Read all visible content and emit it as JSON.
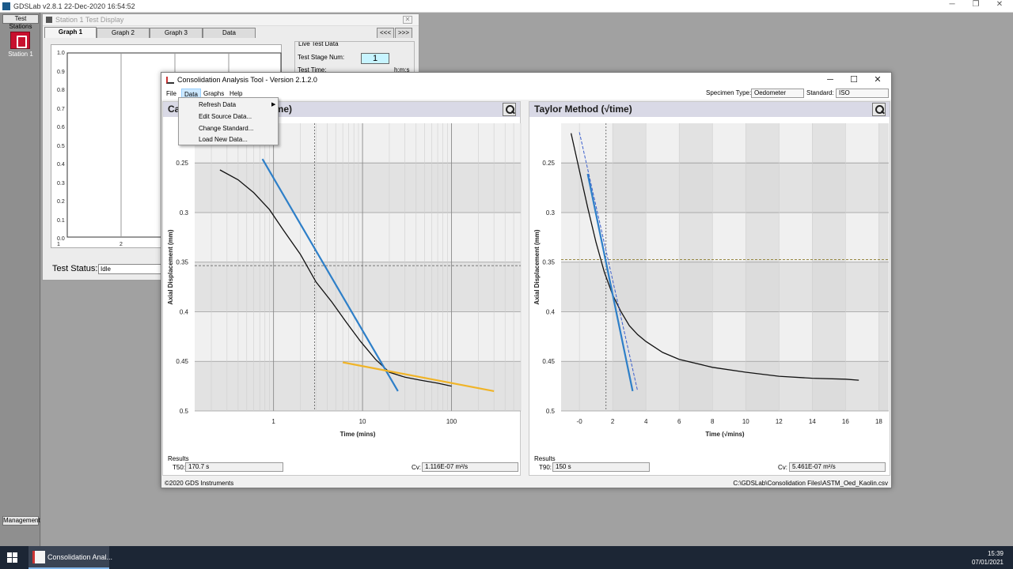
{
  "gdslab": {
    "title": "GDSLab v2.8.1 22-Dec-2020 16:54:52",
    "side_buttons": {
      "test_stations": "Test Stations",
      "management": "Management"
    },
    "station_label": "Station 1"
  },
  "station_window": {
    "title": "Station 1 Test Display",
    "tabs": [
      "Graph 1",
      "Graph 2",
      "Graph 3",
      "Data"
    ],
    "nav": {
      "prev": "<<<",
      "next": ">>>"
    },
    "y_ticks": [
      "1.0",
      "0.9",
      "0.8",
      "0.7",
      "0.6",
      "0.5",
      "0.4",
      "0.3",
      "0.2",
      "0.1",
      "0.0"
    ],
    "x_ticks": [
      "1",
      "2"
    ],
    "live_test_data": {
      "title": "Live Test Data",
      "stage_label": "Test Stage Num:",
      "stage_value": "1",
      "time_label": "Test Time:",
      "time_unit": "h:m:s"
    },
    "status_label": "Test Status:",
    "status_value": "Idle"
  },
  "cat_window": {
    "title": "Consolidation Analysis Tool - Version 2.1.2.0",
    "menu": [
      "File",
      "Data",
      "Graphs",
      "Help"
    ],
    "specimen_label": "Specimen Type:",
    "specimen_value": "Oedometer",
    "standard_label": "Standard:",
    "standard_value": "ISO",
    "copyright": "©2020 GDS Instruments",
    "file_path": "C:\\GDSLab\\Consolidation Files\\ASTM_Oed_Kaolin.csv"
  },
  "data_menu": {
    "items": [
      "Refresh Data",
      "Edit Source Data...",
      "Change Standard...",
      "Load New Data..."
    ]
  },
  "casagrande": {
    "title_visible_left": "Ca",
    "title_visible_right": "time)",
    "ylabel": "Axial Displacement (mm)",
    "xlabel": "Time (mins)",
    "y_ticks": [
      "0.25",
      "0.3",
      "0.35",
      "0.4",
      "0.45",
      "0.5"
    ],
    "x_ticks": [
      "1",
      "10",
      "100"
    ],
    "results_label": "Results",
    "t50_label": "T50:",
    "t50_value": "170.7 s",
    "cv_label": "Cv:",
    "cv_value": "1.116E-07 m²/s"
  },
  "taylor": {
    "title": "Taylor Method (√time)",
    "ylabel": "Axial Displacement (mm)",
    "xlabel": "Time (√mins)",
    "y_ticks": [
      "0.25",
      "0.3",
      "0.35",
      "0.4",
      "0.45",
      "0.5"
    ],
    "x_ticks": [
      "-0",
      "2",
      "4",
      "6",
      "8",
      "10",
      "12",
      "14",
      "16",
      "18"
    ],
    "results_label": "Results",
    "t90_label": "T90:",
    "t90_value": "150 s",
    "cv_label": "Cv:",
    "cv_value": "5.461E-07 m²/s"
  },
  "chart_data": [
    {
      "type": "line",
      "title": "Casagrande Method (log time)",
      "xlabel": "Time (mins)",
      "ylabel": "Axial Displacement (mm)",
      "x_scale": "log",
      "xlim": [
        0.13,
        600
      ],
      "ylim": [
        0.5,
        0.21
      ],
      "series": [
        {
          "x": [
            0.25,
            0.4,
            0.6,
            0.9,
            1.3,
            2.0,
            3.0,
            4.5,
            6.5,
            9.5,
            14,
            20,
            30,
            45,
            70,
            100
          ],
          "y": [
            0.257,
            0.267,
            0.28,
            0.297,
            0.318,
            0.342,
            0.37,
            0.39,
            0.41,
            0.43,
            0.448,
            0.461,
            0.466,
            0.469,
            0.472,
            0.475
          ]
        },
        {
          "x": [
            0.75,
            25
          ],
          "y": [
            0.246,
            0.48
          ]
        },
        {
          "x": [
            6,
            300
          ],
          "y": [
            0.451,
            0.48
          ]
        }
      ],
      "colors": [
        "#111111",
        "#2e7fc8",
        "#f0b428"
      ],
      "reference_x": 2.9,
      "reference_y": 0.3535
    },
    {
      "type": "line",
      "title": "Taylor Method (√time)",
      "xlabel": "Time (√mins)",
      "ylabel": "Axial Displacement (mm)",
      "xlim": [
        -1.1,
        18.6
      ],
      "ylim": [
        0.5,
        0.21
      ],
      "series": [
        {
          "x": [
            -0.5,
            0.5,
            1.0,
            1.5,
            2.0,
            2.5,
            3.0,
            3.5,
            4.0,
            5.0,
            6.0,
            8.0,
            10.0,
            12.0,
            14.0,
            16.0,
            16.8
          ],
          "y": [
            0.22,
            0.295,
            0.33,
            0.36,
            0.383,
            0.4,
            0.414,
            0.423,
            0.43,
            0.441,
            0.448,
            0.456,
            0.461,
            0.465,
            0.467,
            0.468,
            0.469
          ]
        },
        {
          "x": [
            0.5,
            3.2
          ],
          "y": [
            0.261,
            0.48
          ]
        },
        {
          "x": [
            0.0,
            3.5
          ],
          "y": [
            0.219,
            0.48
          ]
        }
      ],
      "colors": [
        "#111111",
        "#2e7fc8",
        "#3a5fcd"
      ],
      "reference_x": 1.6,
      "reference_y": 0.3475
    }
  ],
  "taskbar": {
    "app_label": "Consolidation Anal...",
    "time": "15:39",
    "date": "07/01/2021"
  }
}
